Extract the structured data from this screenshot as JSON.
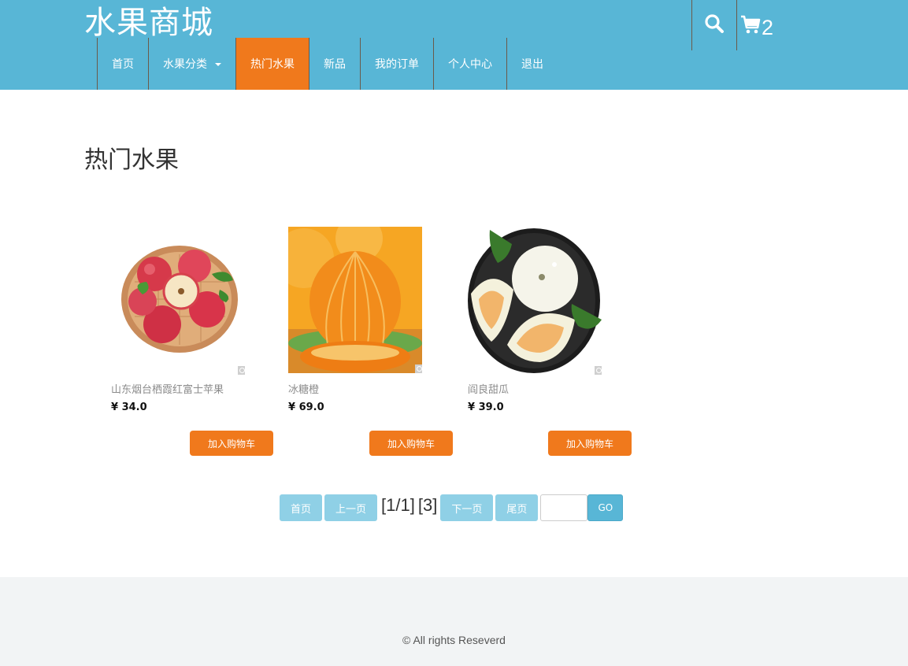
{
  "header": {
    "logo": "水果商城",
    "cart_count": "2",
    "icons": {
      "search": "search-icon",
      "cart": "shopping-cart-icon"
    },
    "nav": [
      {
        "label": "首页",
        "active": false
      },
      {
        "label": "水果分类",
        "active": false,
        "dropdown": true
      },
      {
        "label": "热门水果",
        "active": true
      },
      {
        "label": "新品",
        "active": false
      },
      {
        "label": "我的订单",
        "active": false
      },
      {
        "label": "个人中心",
        "active": false
      },
      {
        "label": "退出",
        "active": false
      }
    ]
  },
  "main": {
    "title": "热门水果",
    "products": [
      {
        "name": "山东烟台栖霞红富士苹果",
        "price": "¥ 34.0",
        "image": "apple-basket",
        "button": "加入购物车"
      },
      {
        "name": "冰糖橙",
        "price": "¥ 69.0",
        "image": "orange",
        "button": "加入购物车"
      },
      {
        "name": "阎良甜瓜",
        "price": "¥ 39.0",
        "image": "melon-plate",
        "button": "加入购物车"
      }
    ]
  },
  "pagination": {
    "first": "首页",
    "prev": "上一页",
    "page_info": "[1/1]",
    "total": "[3]",
    "next": "下一页",
    "last": "尾页",
    "input_value": "",
    "go": "GO"
  },
  "footer": {
    "copyright": "© All rights Reseverd"
  },
  "colors": {
    "header_bg": "#58b6d6",
    "accent": "#f0791c",
    "pager_btn": "#8fd0e6",
    "footer_bg": "#f2f4f5"
  }
}
